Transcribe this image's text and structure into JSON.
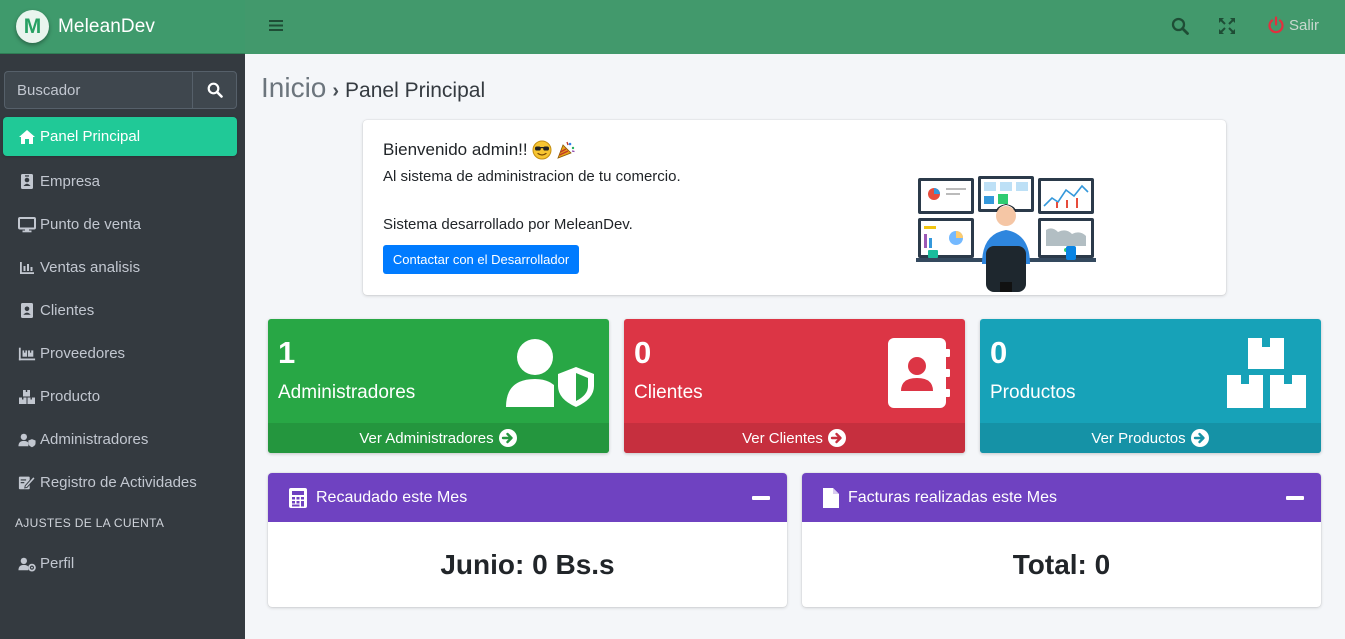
{
  "brand": {
    "logo_letter": "M",
    "name": "MeleanDev"
  },
  "search": {
    "placeholder": "Buscador"
  },
  "sidebar": {
    "items": [
      {
        "label": "Panel Principal",
        "icon": "home-icon"
      },
      {
        "label": "Empresa",
        "icon": "id-badge-icon"
      },
      {
        "label": "Punto de venta",
        "icon": "desktop-icon"
      },
      {
        "label": "Ventas analisis",
        "icon": "chart-bar-icon"
      },
      {
        "label": "Clientes",
        "icon": "contact-book-icon"
      },
      {
        "label": "Proveedores",
        "icon": "pallet-icon"
      },
      {
        "label": "Producto",
        "icon": "boxes-icon"
      },
      {
        "label": "Administradores",
        "icon": "user-shield-icon"
      },
      {
        "label": "Registro de Actividades",
        "icon": "signature-icon"
      }
    ],
    "section_header": "AJUSTES DE LA CUENTA",
    "profile": {
      "label": "Perfil",
      "icon": "user-cog-icon"
    }
  },
  "topbar": {
    "logout_label": "Salir"
  },
  "breadcrumb": {
    "home": "Inicio",
    "separator": "›",
    "current": "Panel Principal"
  },
  "welcome": {
    "title": "Bienvenido admin!!",
    "subtitle": "Al sistema de administracion de tu comercio.",
    "developer": "Sistema desarrollado por MeleanDev.",
    "button": "Contactar con el Desarrollador"
  },
  "cards": [
    {
      "count": "1",
      "label": "Administradores",
      "footer": "Ver Administradores",
      "color": "#28a745"
    },
    {
      "count": "0",
      "label": "Clientes",
      "footer": "Ver Clientes",
      "color": "#dc3545"
    },
    {
      "count": "0",
      "label": "Productos",
      "footer": "Ver Productos",
      "color": "#17a2b8"
    }
  ],
  "panels": [
    {
      "title": "Recaudado este Mes",
      "value": "Junio: 0 Bs.s",
      "icon": "calculator-icon"
    },
    {
      "title": "Facturas realizadas este Mes",
      "value": "Total: 0",
      "icon": "file-icon"
    }
  ],
  "colors": {
    "topbar": "#42996c",
    "sidebar": "#343a40",
    "active": "#20c997",
    "panel_header": "#6f42c1",
    "button": "#007bff"
  }
}
